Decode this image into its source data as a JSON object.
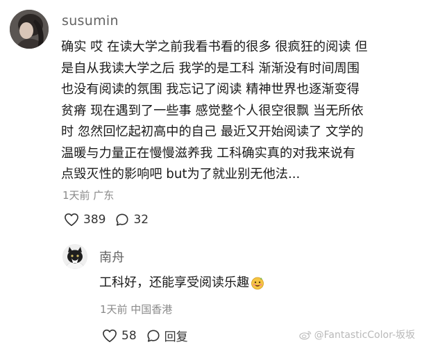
{
  "main_comment": {
    "username": "susumin",
    "text": "确实 哎 在读大学之前我看书看的很多 很疯狂的阅读 但\n是自从我读大学之后 我学的是工科 渐渐没有时间周围\n也没有阅读的氛围 我忘记了阅读 精神世界也逐渐变得\n贫瘠 现在遇到了一些事 感觉整个人很空很飘 当无所依\n时 忽然回忆起初高中的自己 最近又开始阅读了 文学的\n温暖与力量正在慢慢滋养我 工科确实真的对我来说有\n点毁灭性的影响吧 but为了就业别无他法...",
    "meta": "1天前 广东",
    "likes": "389",
    "comments": "32"
  },
  "reply": {
    "username": "南舟",
    "text": "工科好，还能享受阅读乐趣",
    "meta": "1天前 中国香港",
    "likes": "58",
    "reply_label": "回复"
  },
  "watermark": "@FantasticColor-坂坂",
  "icons": {
    "like": "heart-outline-icon",
    "comment": "speech-bubble-icon",
    "emoji": "smiling-face-emoji-icon",
    "watermark": "weibo-logo-icon"
  },
  "colors": {
    "text": "#1a1a1a",
    "meta": "#8a8a8a",
    "username": "#636363"
  }
}
